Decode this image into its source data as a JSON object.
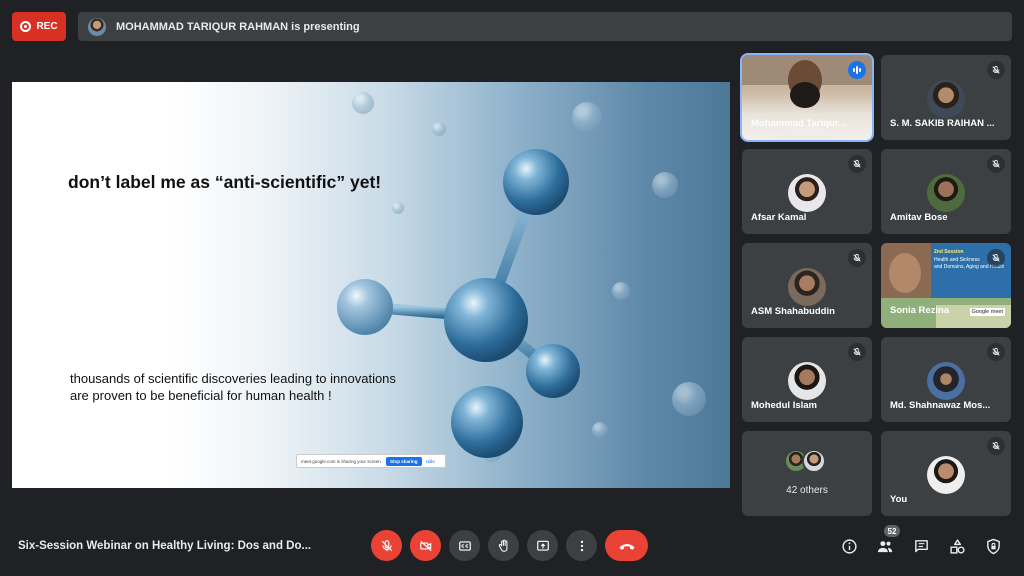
{
  "recording": {
    "label": "REC"
  },
  "presenter_bar": {
    "text": "MOHAMMAD TARIQUR RAHMAN is presenting"
  },
  "slide": {
    "heading": "don’t label me as “anti-scientific” yet!",
    "body_line1": "thousands of scientific discoveries leading to innovations",
    "body_line2": "are proven to be beneficial for human health !",
    "share_notice": {
      "text": "meet.google.com is sharing your screen.",
      "stop_label": "Stop sharing",
      "hide_label": "Hide"
    }
  },
  "participants": [
    {
      "name": "Mohammad Tariqur...",
      "speaking": true
    },
    {
      "name": "S. M. SAKIB RAIHAN ...",
      "muted": true
    },
    {
      "name": "Afsar Kamal",
      "muted": true
    },
    {
      "name": "Amitav Bose",
      "muted": true
    },
    {
      "name": "ASM Shahabuddin",
      "muted": true
    },
    {
      "name": "Sonia Rezina",
      "muted": true,
      "video_text": {
        "session": "2nd Session",
        "topic1": "Health and Sickness",
        "topic2": "and Domains, Aging and Health",
        "logo": "Google meet"
      }
    },
    {
      "name": "Mohedul Islam",
      "muted": true
    },
    {
      "name": "Md. Shahnawaz Mos...",
      "muted": true
    },
    {
      "name": "42 others"
    },
    {
      "name": "You",
      "muted": true
    }
  ],
  "meeting": {
    "title": "Six-Session Webinar on Healthy Living: Dos and Do..."
  },
  "people_count": "52",
  "colors": {
    "red": "#ea4335",
    "bar": "#3c4043",
    "background": "#202124",
    "accent": "#1a73e8"
  },
  "controls": [
    "mic-off-icon",
    "camera-off-icon",
    "captions-icon",
    "raise-hand-icon",
    "present-icon",
    "more-options-icon",
    "end-call-icon"
  ],
  "side_icons": [
    "info-icon",
    "people-icon",
    "chat-icon",
    "activities-icon",
    "host-controls-icon"
  ]
}
